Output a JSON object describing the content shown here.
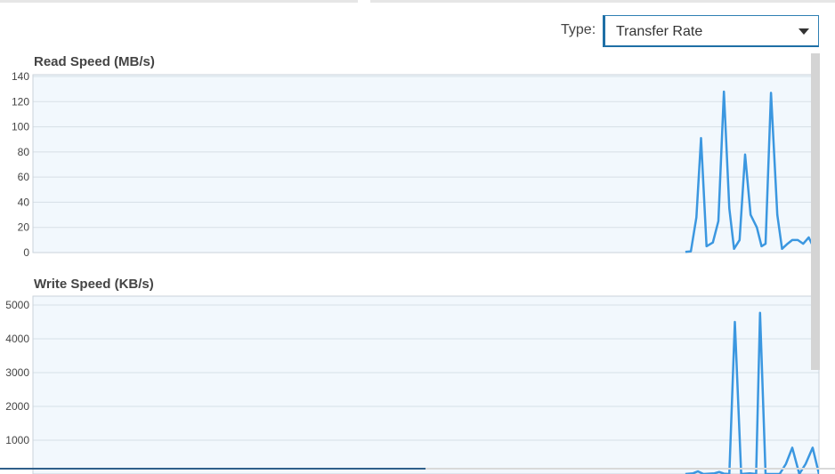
{
  "controls": {
    "type_label": "Type:",
    "type_value": "Transfer Rate",
    "dropdown_icon": "caret-down-icon"
  },
  "colors": {
    "line": "#3b97e0",
    "plot_bg": "#f2f8fd",
    "grid": "#d7dfe6",
    "border": "#c9d2da"
  },
  "chart_data": [
    {
      "type": "line",
      "title": "Read Speed (MB/s)",
      "ylim": [
        0,
        140
      ],
      "yticks": [
        0,
        20,
        40,
        60,
        80,
        100,
        120,
        140
      ],
      "grid": true,
      "x_range": [
        0,
        1
      ],
      "series": [
        {
          "points": [
            [
              0.83,
              0.5
            ],
            [
              0.837,
              1
            ],
            [
              0.844,
              28
            ],
            [
              0.85,
              91
            ],
            [
              0.857,
              5
            ],
            [
              0.865,
              8
            ],
            [
              0.872,
              25
            ],
            [
              0.879,
              128
            ],
            [
              0.886,
              35
            ],
            [
              0.892,
              3
            ],
            [
              0.899,
              10
            ],
            [
              0.906,
              78
            ],
            [
              0.913,
              30
            ],
            [
              0.921,
              20
            ],
            [
              0.927,
              5
            ],
            [
              0.932,
              7
            ],
            [
              0.939,
              127
            ],
            [
              0.947,
              30
            ],
            [
              0.953,
              3
            ],
            [
              0.96,
              7
            ],
            [
              0.966,
              10
            ],
            [
              0.973,
              10
            ],
            [
              0.98,
              7
            ],
            [
              0.987,
              12
            ],
            [
              0.994,
              3
            ],
            [
              1.001,
              2
            ],
            [
              1.008,
              3
            ],
            [
              1.015,
              4
            ],
            [
              1.022,
              3
            ],
            [
              1.029,
              3
            ],
            [
              1.036,
              2
            ],
            [
              1.043,
              2
            ],
            [
              1.05,
              3
            ],
            [
              1.057,
              5
            ],
            [
              1.062,
              4
            ]
          ]
        }
      ]
    },
    {
      "type": "line",
      "title": "Write Speed (KB/s)",
      "ylim": [
        0,
        5000
      ],
      "yticks": [
        1000,
        2000,
        3000,
        4000,
        5000
      ],
      "grid": true,
      "x_range": [
        0,
        1
      ],
      "series": [
        {
          "points": [
            [
              0.83,
              0
            ],
            [
              0.84,
              20
            ],
            [
              0.846,
              80
            ],
            [
              0.853,
              0
            ],
            [
              0.867,
              20
            ],
            [
              0.873,
              60
            ],
            [
              0.879,
              10
            ],
            [
              0.886,
              0
            ],
            [
              0.893,
              4500
            ],
            [
              0.901,
              0
            ],
            [
              0.912,
              20
            ],
            [
              0.92,
              0
            ],
            [
              0.925,
              4770
            ],
            [
              0.932,
              0
            ],
            [
              0.95,
              0
            ],
            [
              0.958,
              300
            ],
            [
              0.966,
              780
            ],
            [
              0.975,
              0
            ],
            [
              0.983,
              300
            ],
            [
              0.992,
              780
            ],
            [
              1.0,
              0
            ],
            [
              1.06,
              0
            ]
          ]
        }
      ]
    }
  ]
}
